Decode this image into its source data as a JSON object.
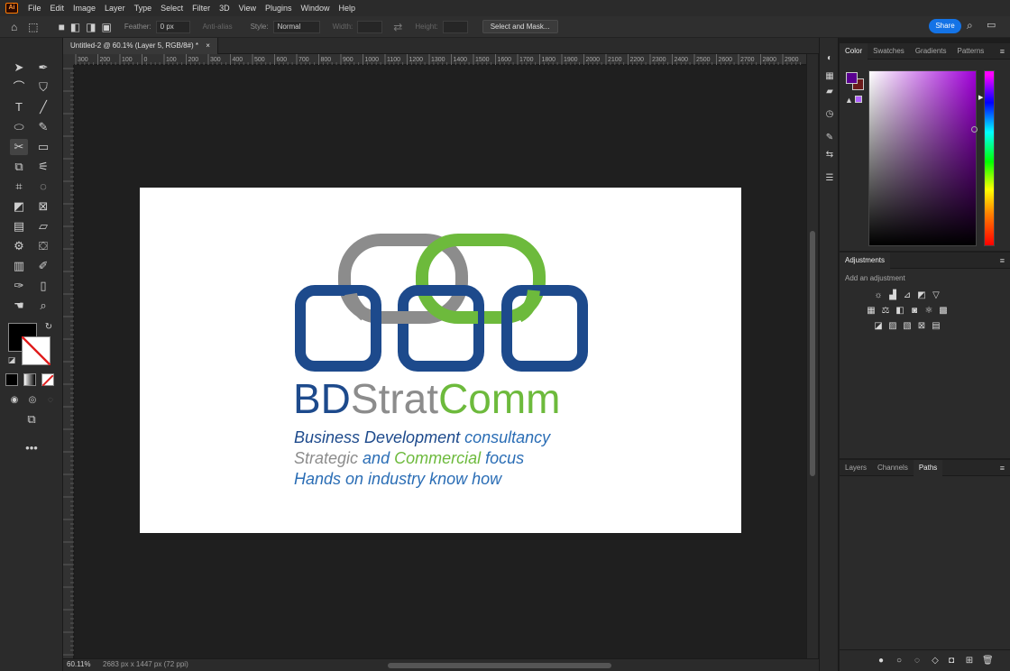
{
  "app": {
    "logo_text": "Ai"
  },
  "menu": [
    "File",
    "Edit",
    "Image",
    "Layer",
    "Type",
    "Select",
    "Filter",
    "3D",
    "View",
    "Plugins",
    "Window",
    "Help"
  ],
  "options": {
    "feather_label": "Feather:",
    "feather_value": "0 px",
    "anti_alias_label": "Anti-alias",
    "style_label": "Style:",
    "style_value": "Normal",
    "width_label": "Width:",
    "height_label": "Height:",
    "select_mask_label": "Select and Mask...",
    "share_label": "Share"
  },
  "document": {
    "tab_title": "Untitled-2 @ 60.1% (Layer 5, RGB/8#) *",
    "zoom": "60.11%",
    "size": "2683 px x 1447 px (72 ppi)"
  },
  "ruler": {
    "top_labels": [
      "300",
      "200",
      "100",
      "0",
      "100",
      "200",
      "300",
      "400",
      "500",
      "600",
      "700",
      "800",
      "900",
      "1000",
      "1100",
      "1200",
      "1300",
      "1400",
      "1500",
      "1600",
      "1700",
      "1800",
      "1900",
      "2000",
      "2100",
      "2200",
      "2300",
      "2400",
      "2500",
      "2600",
      "2700",
      "2800",
      "2900"
    ]
  },
  "logo": {
    "word_bd": "BD",
    "word_strat": "Strat",
    "word_comm": "Comm",
    "line1_a": "Business Development",
    "line1_b": " consultancy",
    "line2_a": "Strategic ",
    "line2_b": "and ",
    "line2_c": "Commercial ",
    "line2_d": "focus",
    "line3": "Hands on industry know how",
    "colors": {
      "blue": "#1d4a8c",
      "grey": "#8c8c8c",
      "green": "#6dba3c",
      "mid_blue": "#2a6db5"
    }
  },
  "panels": {
    "color_tabs": [
      "Color",
      "Swatches",
      "Gradients",
      "Patterns"
    ],
    "adjustments_title": "Adjustments",
    "adjustments_hint": "Add an adjustment",
    "layers_tabs": [
      "Layers",
      "Channels",
      "Paths"
    ]
  }
}
